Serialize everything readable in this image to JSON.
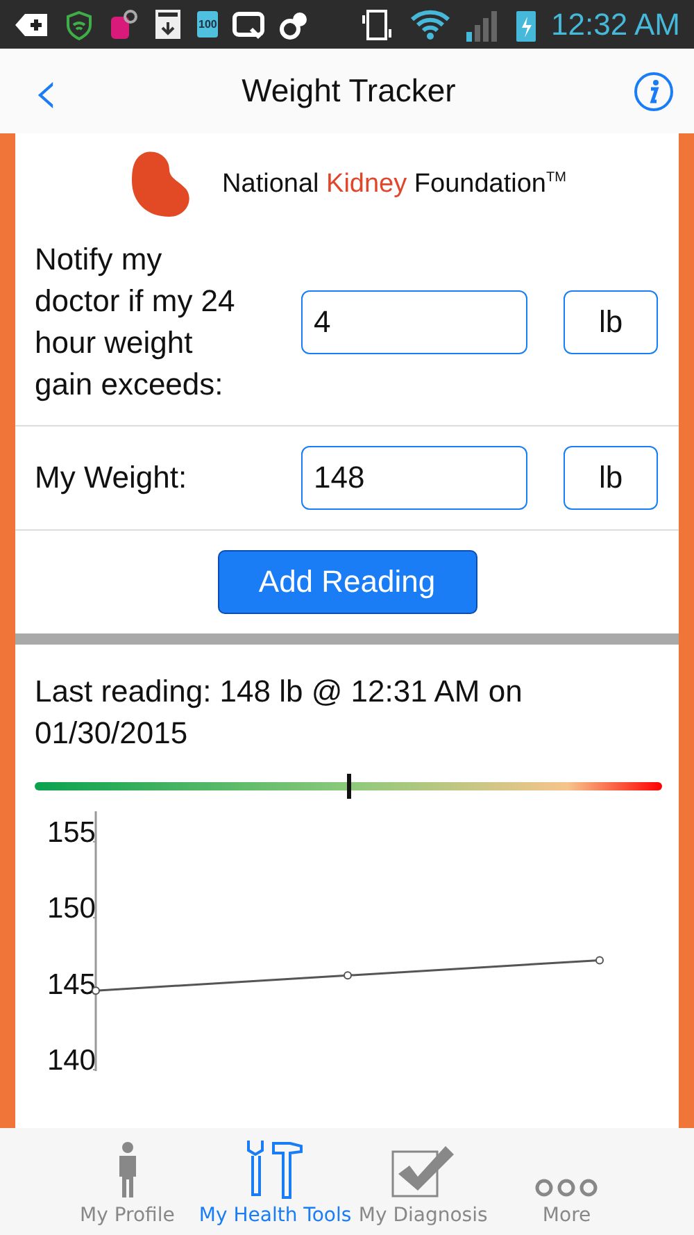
{
  "status_bar": {
    "battery_widget_label": "100",
    "time": "12:32 AM"
  },
  "nav": {
    "back_icon": "‹",
    "title": "Weight Tracker"
  },
  "logo": {
    "text": "National ",
    "highlight": "Kidney",
    "rest": " Foundation",
    "mark": "TM"
  },
  "form": {
    "rows": [
      {
        "label": "Notify my doctor if my 24 hour weight gain exceeds:",
        "value": "4",
        "unit": "lb"
      },
      {
        "label": "My Weight:",
        "value": "148",
        "unit": "lb"
      }
    ],
    "button": "Add Reading"
  },
  "reading": {
    "text": "Last reading: 148 lb @ 12:31 AM on 01/30/2015",
    "meter": {
      "level": 0.5
    },
    "chart_data": {
      "type": "line",
      "series": [
        {
          "color": "#555555",
          "marker": "circle",
          "values": [
            145.2,
            146.2,
            147.2
          ]
        }
      ],
      "ylim": [
        140,
        157
      ],
      "yticks": [
        140,
        145,
        150,
        155
      ]
    }
  },
  "tabs": [
    {
      "label": "My Profile",
      "kind": "person",
      "selected": false
    },
    {
      "label": "My Health Tools",
      "kind": "tools",
      "selected": true
    },
    {
      "label": "My Diagnosis",
      "kind": "check",
      "selected": false
    },
    {
      "label": "More",
      "kind": "dots",
      "selected": false
    }
  ]
}
